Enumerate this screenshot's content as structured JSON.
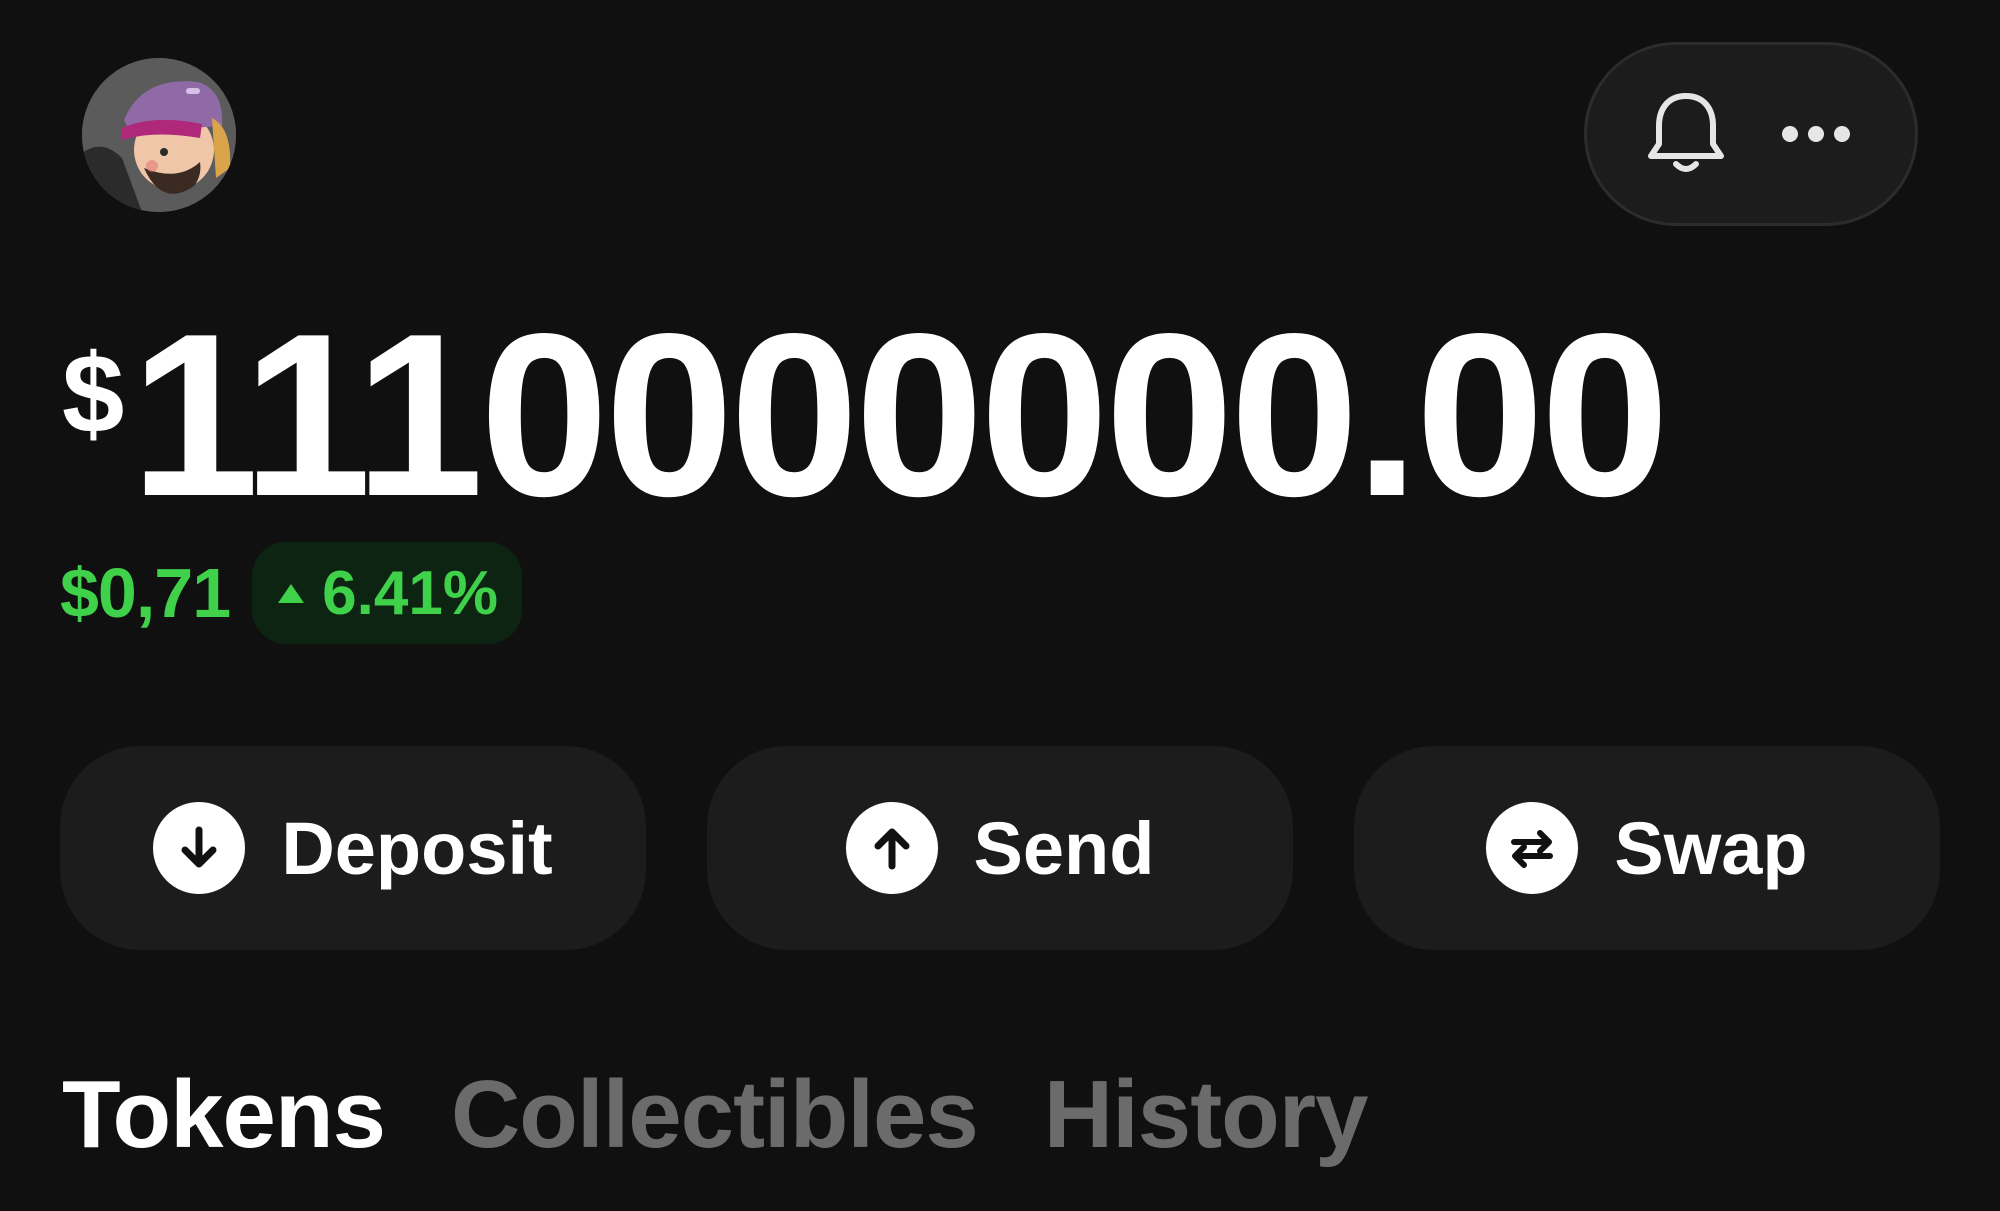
{
  "header": {
    "avatar_icon": "user-avatar-cartoon",
    "notifications_icon": "bell-icon",
    "more_icon": "ellipsis-icon"
  },
  "balance": {
    "currency_symbol": "$",
    "amount": "1110000000.00"
  },
  "change": {
    "value": "$0,71",
    "direction_icon": "triangle-up-icon",
    "percent": "6.41%",
    "color": "#3fd14a"
  },
  "actions": [
    {
      "label": "Deposit",
      "icon": "arrow-down-circle-icon"
    },
    {
      "label": "Send",
      "icon": "arrow-up-circle-icon"
    },
    {
      "label": "Swap",
      "icon": "swap-arrows-circle-icon"
    }
  ],
  "tabs": [
    {
      "label": "Tokens",
      "active": true
    },
    {
      "label": "Collectibles",
      "active": false
    },
    {
      "label": "History",
      "active": false
    }
  ],
  "colors": {
    "background": "#101010",
    "surface": "#1c1c1c",
    "accent_positive": "#3fd14a",
    "tab_inactive": "#6b6b6b"
  }
}
